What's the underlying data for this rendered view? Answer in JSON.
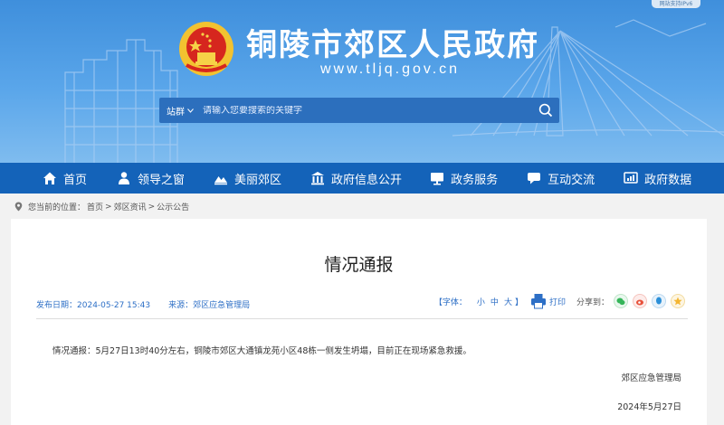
{
  "header": {
    "top_badge": "网站支持IPv6",
    "site_title": "铜陵市郊区人民政府",
    "site_url": "www.tljq.gov.cn"
  },
  "search": {
    "scope_label": "站群",
    "placeholder": "请输入您要搜索的关键字"
  },
  "nav": {
    "items": [
      {
        "label": "首页",
        "icon": "home-icon"
      },
      {
        "label": "领导之窗",
        "icon": "leader-icon"
      },
      {
        "label": "美丽郊区",
        "icon": "landscape-icon"
      },
      {
        "label": "政府信息公开",
        "icon": "government-icon"
      },
      {
        "label": "政务服务",
        "icon": "monitor-icon"
      },
      {
        "label": "互动交流",
        "icon": "chat-icon"
      },
      {
        "label": "政府数据",
        "icon": "data-icon"
      }
    ]
  },
  "breadcrumb": {
    "prefix": "您当前的位置：",
    "items": [
      "首页",
      "郊区资讯",
      "公示公告"
    ],
    "separator": " > "
  },
  "article": {
    "title": "情况通报",
    "publish_label": "发布日期：",
    "publish_date": "2024-05-27 15:43",
    "source_label": "来源：",
    "source": "郊区应急管理局",
    "font_label": "【字体：",
    "font_small": "小",
    "font_medium": "中",
    "font_large": "大",
    "font_close": "】",
    "print_label": "打印",
    "share_label": "分享到：",
    "body": "情况通报：5月27日13时40分左右，铜陵市郊区大通镇龙苑小区48栋一侧发生坍塌，目前正在现场紧急救援。",
    "signature": "郊区应急管理局",
    "date": "2024年5月27日"
  },
  "colors": {
    "nav_bg": "#1463b9",
    "accent": "#2d6fc6",
    "wechat": "#35b559",
    "weibo": "#e8503a",
    "qq": "#2b8fd8",
    "qzone": "#f4b530"
  }
}
